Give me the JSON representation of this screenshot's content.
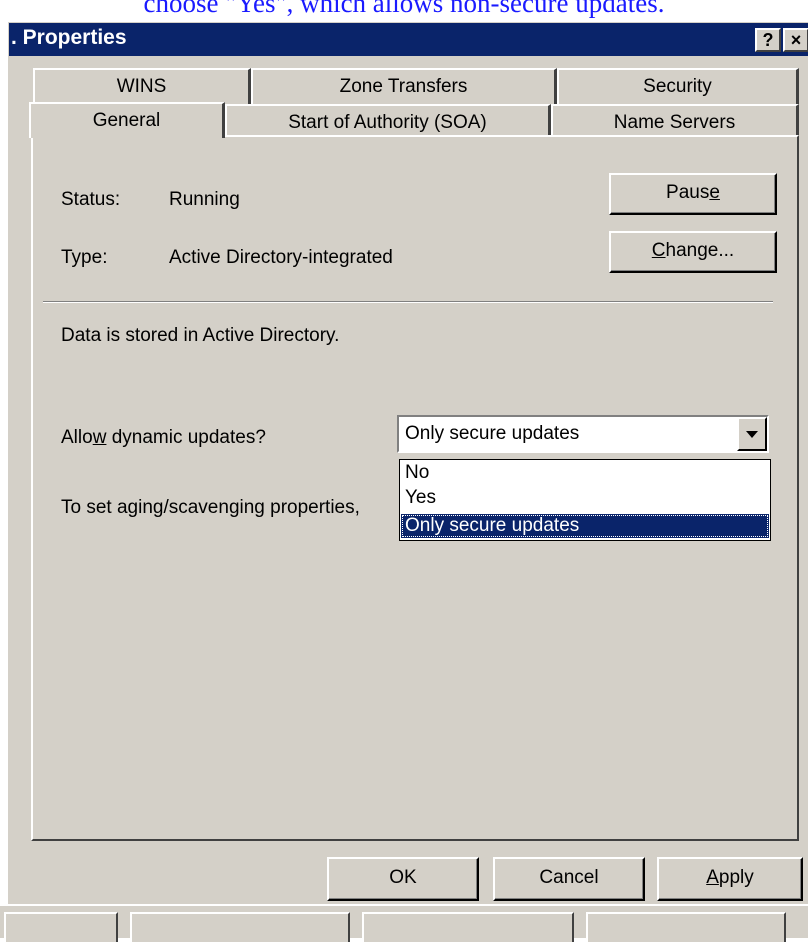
{
  "caption": {
    "text": "choose \"Yes\", which allows non-secure updates."
  },
  "window": {
    "title": ". Properties",
    "help_button": "?",
    "close_button": "×"
  },
  "tabs": {
    "row1": [
      "WINS",
      "Zone Transfers",
      "Security"
    ],
    "row2": [
      "General",
      "Start of Authority (SOA)",
      "Name Servers"
    ],
    "active": "General"
  },
  "general": {
    "status_label": "Status:",
    "status_value": "Running",
    "type_label": "Type:",
    "type_value": "Active Directory-integrated",
    "pause_button": {
      "pre": "Paus",
      "accel": "e",
      "post": ""
    },
    "change_button": {
      "pre": "",
      "accel": "C",
      "post": "hange..."
    },
    "storage_text": "Data is stored in Active Directory.",
    "dynamic_updates_label": {
      "pre": "Allo",
      "accel": "w",
      "post": " dynamic updates?"
    },
    "dynamic_updates_value": "Only secure updates",
    "dynamic_updates_options": [
      "No",
      "Yes",
      "Only secure updates"
    ],
    "selected_option_index": 2,
    "aging_text": "To set aging/scavenging properties,"
  },
  "footer": {
    "ok_button": "OK",
    "cancel_button": "Cancel",
    "apply_button": {
      "pre": "",
      "accel": "A",
      "post": "pply"
    }
  },
  "colors": {
    "title_bar": "#0a246a",
    "dialog_face": "#d4d0c8",
    "selection": "#0a246a",
    "caption_text": "#1a1aff"
  }
}
